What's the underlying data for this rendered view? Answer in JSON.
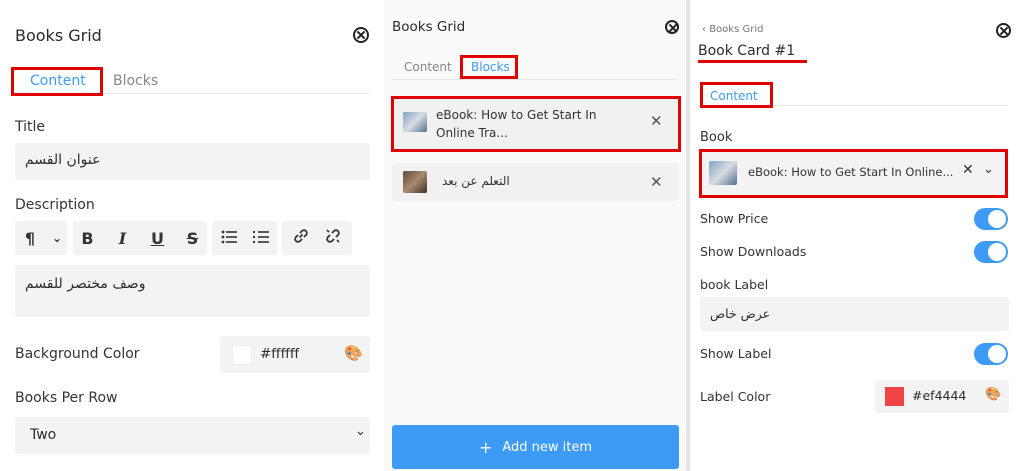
{
  "left": {
    "title": "Books Grid",
    "tabs": [
      "Content",
      "Blocks"
    ],
    "title_label": "Title",
    "title_value": "عنوان القسم",
    "description_label": "Description",
    "toolbar": {
      "paragraph": "¶",
      "bold": "B",
      "italic": "I",
      "underline": "U",
      "strike": "S"
    },
    "description_value": "وصف مختصر للقسم",
    "bg_color_label": "Background Color",
    "bg_color_value": "#ffffff",
    "books_per_row_label": "Books Per Row",
    "books_per_row_value": "Two"
  },
  "middle": {
    "title": "Books Grid",
    "tabs": [
      "Content",
      "Blocks"
    ],
    "items": [
      {
        "label": "eBook: How to Get Start In Online Tra..."
      },
      {
        "label": "التعلم عن بعد"
      }
    ],
    "add_button": "Add new item"
  },
  "right": {
    "breadcrumb": "Books Grid",
    "title": "Book Card #1",
    "tab": "Content",
    "book_label": "Book",
    "book_value": "eBook: How to Get Start In Online...",
    "show_price_label": "Show Price",
    "show_downloads_label": "Show Downloads",
    "book_label_label": "book Label",
    "book_label_value": "عرض خاص",
    "show_label_label": "Show Label",
    "label_color_label": "Label Color",
    "label_color_value": "#ef4444"
  },
  "colors": {
    "accent": "#3d9bf5",
    "highlight": "#e00000",
    "label_swatch": "#ef4444"
  }
}
